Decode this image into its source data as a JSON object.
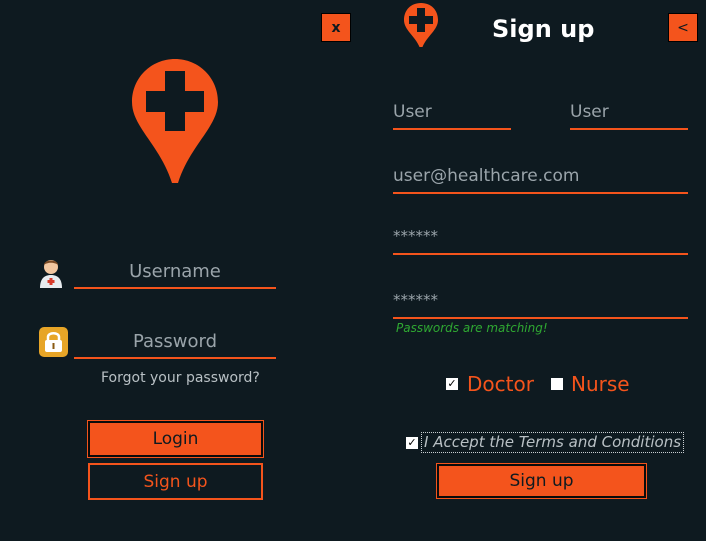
{
  "colors": {
    "accent": "#f4541c",
    "background": "#0e1a20",
    "muted_text": "#9aa4aa",
    "success": "#2fa832"
  },
  "login": {
    "close_label": "x",
    "username_placeholder": "Username",
    "password_placeholder": "Password",
    "forgot_link": "Forgot your password?",
    "login_button": "Login",
    "signup_button": "Sign up",
    "icons": [
      "map-pin-plus-icon",
      "doctor-avatar-icon",
      "padlock-icon"
    ]
  },
  "signup": {
    "title": "Sign up",
    "back_label": "<",
    "first_name": "User",
    "last_name": "User",
    "email": "user@healthcare.com",
    "password": "******",
    "confirm_password": "******",
    "match_message": "Passwords are matching!",
    "role_doctor": "Doctor",
    "role_doctor_checked": true,
    "role_nurse": "Nurse",
    "role_nurse_checked": false,
    "terms_label": "I Accept the Terms and Conditions",
    "terms_checked": true,
    "submit_button": "Sign up"
  }
}
